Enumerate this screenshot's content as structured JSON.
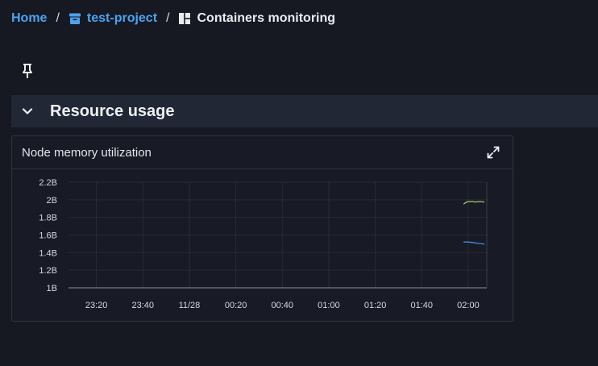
{
  "breadcrumb": {
    "home_label": "Home",
    "project_label": "test-project",
    "current_label": "Containers monitoring",
    "separator": "/"
  },
  "section": {
    "title": "Resource usage"
  },
  "panel": {
    "title": "Node memory utilization"
  },
  "colors": {
    "link": "#4aa3f0",
    "series_1": "#a8c96a",
    "series_2": "#3f8fdc"
  },
  "chart_data": {
    "type": "line",
    "x_ticks": [
      "23:20",
      "23:40",
      "11/28",
      "00:20",
      "00:40",
      "01:00",
      "01:20",
      "01:40",
      "02:00"
    ],
    "y_ticks": [
      "2.2B",
      "2B",
      "1.8B",
      "1.6B",
      "1.4B",
      "1.2B",
      "1B"
    ],
    "ylim": [
      1,
      2.2
    ],
    "xlim": [
      "23:08",
      "02:08"
    ],
    "grid": true,
    "series": [
      {
        "color": "#a8c96a",
        "points": [
          [
            "01:58",
            1.95
          ],
          [
            "01:59",
            1.97
          ],
          [
            "02:00",
            1.98
          ],
          [
            "02:01",
            1.98
          ],
          [
            "02:02",
            1.98
          ],
          [
            "02:03",
            1.975
          ],
          [
            "02:05",
            1.98
          ],
          [
            "02:07",
            1.975
          ]
        ]
      },
      {
        "color": "#3f8fdc",
        "points": [
          [
            "01:58",
            1.52
          ],
          [
            "02:00",
            1.52
          ],
          [
            "02:02",
            1.515
          ],
          [
            "02:04",
            1.505
          ],
          [
            "02:06",
            1.5
          ],
          [
            "02:07",
            1.495
          ]
        ]
      }
    ]
  }
}
